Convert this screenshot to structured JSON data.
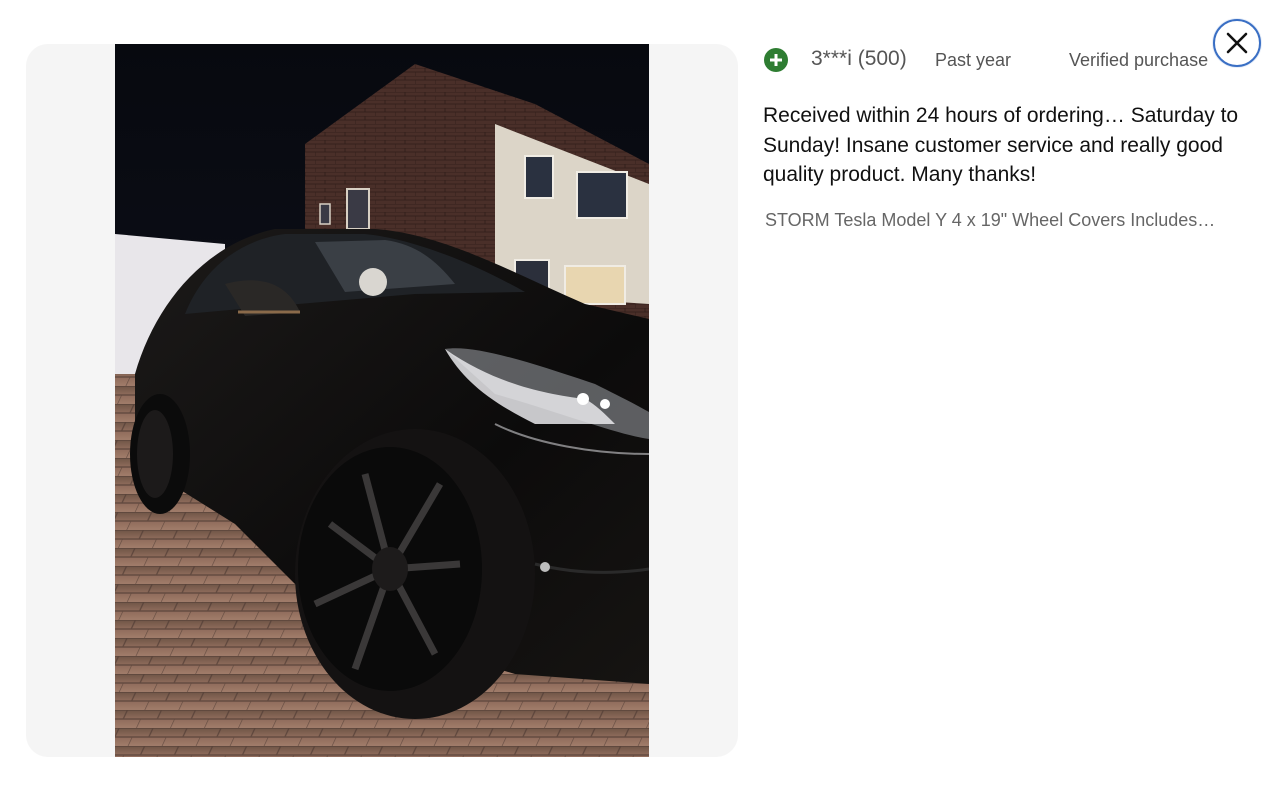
{
  "review": {
    "reviewer_name": "3***i (500)",
    "date": "Past year",
    "verified": "Verified purchase",
    "text": "Received within 24 hours of ordering… Saturday to Sunday! Insane customer service and really good quality product. Many thanks!",
    "product_title": "STORM Tesla Model Y 4 x 19\" Wheel Covers Includes…"
  },
  "icons": {
    "badge": "plus-circle-icon",
    "close": "close-icon"
  },
  "colors": {
    "badge_green": "#2e7d32",
    "close_ring": "#3a6fc4",
    "panel_bg": "#f5f5f5"
  }
}
